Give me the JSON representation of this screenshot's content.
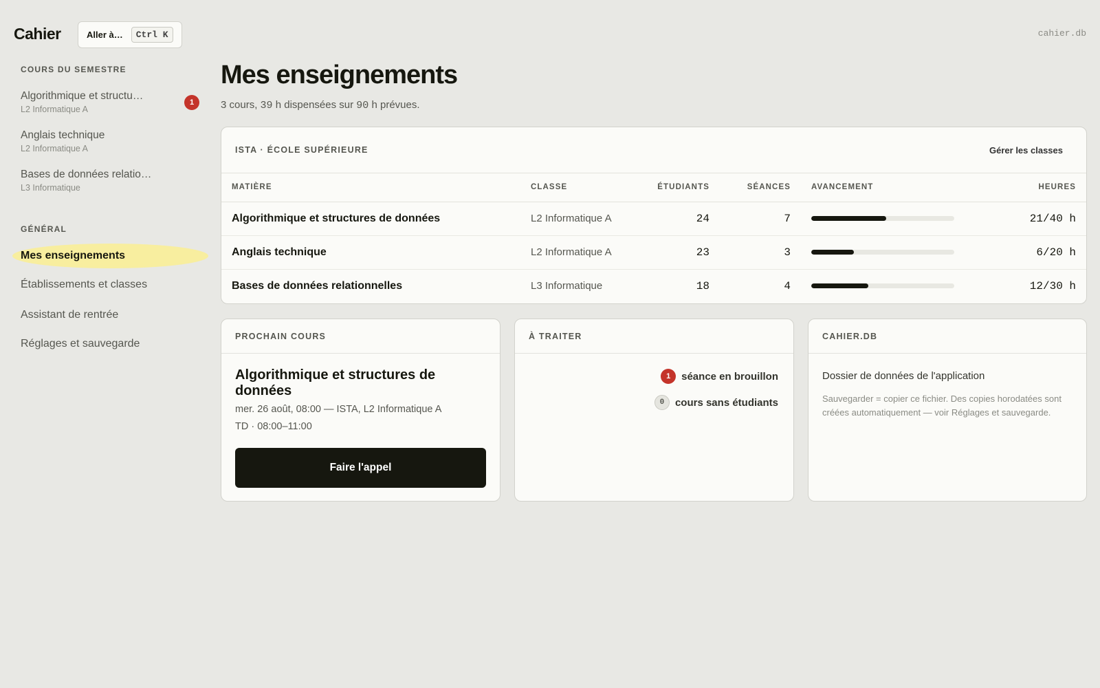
{
  "app": {
    "name": "Cahier",
    "db_label": "cahier.db"
  },
  "goto": {
    "label": "Aller à…",
    "shortcut": "Ctrl K"
  },
  "sidebar": {
    "courses_heading": "COURS DU SEMESTRE",
    "courses": [
      {
        "title": "Algorithmique et structu…",
        "subtitle": "L2 Informatique A",
        "badge": "1"
      },
      {
        "title": "Anglais technique",
        "subtitle": "L2 Informatique A"
      },
      {
        "title": "Bases de données relatio…",
        "subtitle": "L3 Informatique"
      }
    ],
    "general_heading": "GÉNÉRAL",
    "nav": [
      {
        "label": "Mes enseignements",
        "active": true
      },
      {
        "label": "Établissements et classes"
      },
      {
        "label": "Assistant de rentrée"
      },
      {
        "label": "Réglages et sauvegarde"
      }
    ]
  },
  "main": {
    "title": "Mes enseignements",
    "summary": {
      "pre": "3 cours, ",
      "hours_done": "39",
      "mid": " h dispensées sur ",
      "hours_total": "90",
      "post": " h prévues."
    }
  },
  "table": {
    "school": "ISTA · ÉCOLE SUPÉRIEURE",
    "manage_label": "Gérer les classes",
    "columns": [
      "MATIÈRE",
      "CLASSE",
      "ÉTUDIANTS",
      "SÉANCES",
      "AVANCEMENT",
      "HEURES"
    ],
    "rows": [
      {
        "subject": "Algorithmique et structures de données",
        "class": "L2 Informatique A",
        "students": "24",
        "sessions": "7",
        "progress": 0.525,
        "hours": "21/40 h"
      },
      {
        "subject": "Anglais technique",
        "class": "L2 Informatique A",
        "students": "23",
        "sessions": "3",
        "progress": 0.3,
        "hours": "6/20 h"
      },
      {
        "subject": "Bases de données relationnelles",
        "class": "L3 Informatique",
        "students": "18",
        "sessions": "4",
        "progress": 0.4,
        "hours": "12/30 h"
      }
    ]
  },
  "next_course": {
    "heading": "PROCHAIN COURS",
    "title": "Algorithmique et structures de données",
    "when": "mer. 26 août, 08:00 — ISTA, L2 Informatique A",
    "type": "TD · 08:00–11:00",
    "button": "Faire l'appel"
  },
  "todo": {
    "heading": "À TRAITER",
    "items": [
      {
        "count": "1",
        "label": "séance en brouillon",
        "accent": "#c4342a"
      },
      {
        "count": "0",
        "label": "cours sans étudiants"
      }
    ]
  },
  "db": {
    "heading": "CAHIER.DB",
    "title": "Dossier de données de l'application",
    "description": "Sauvegarder = copier ce fichier. Des copies horodatées sont créées automatiquement — voir Réglages et sauvegarde."
  }
}
